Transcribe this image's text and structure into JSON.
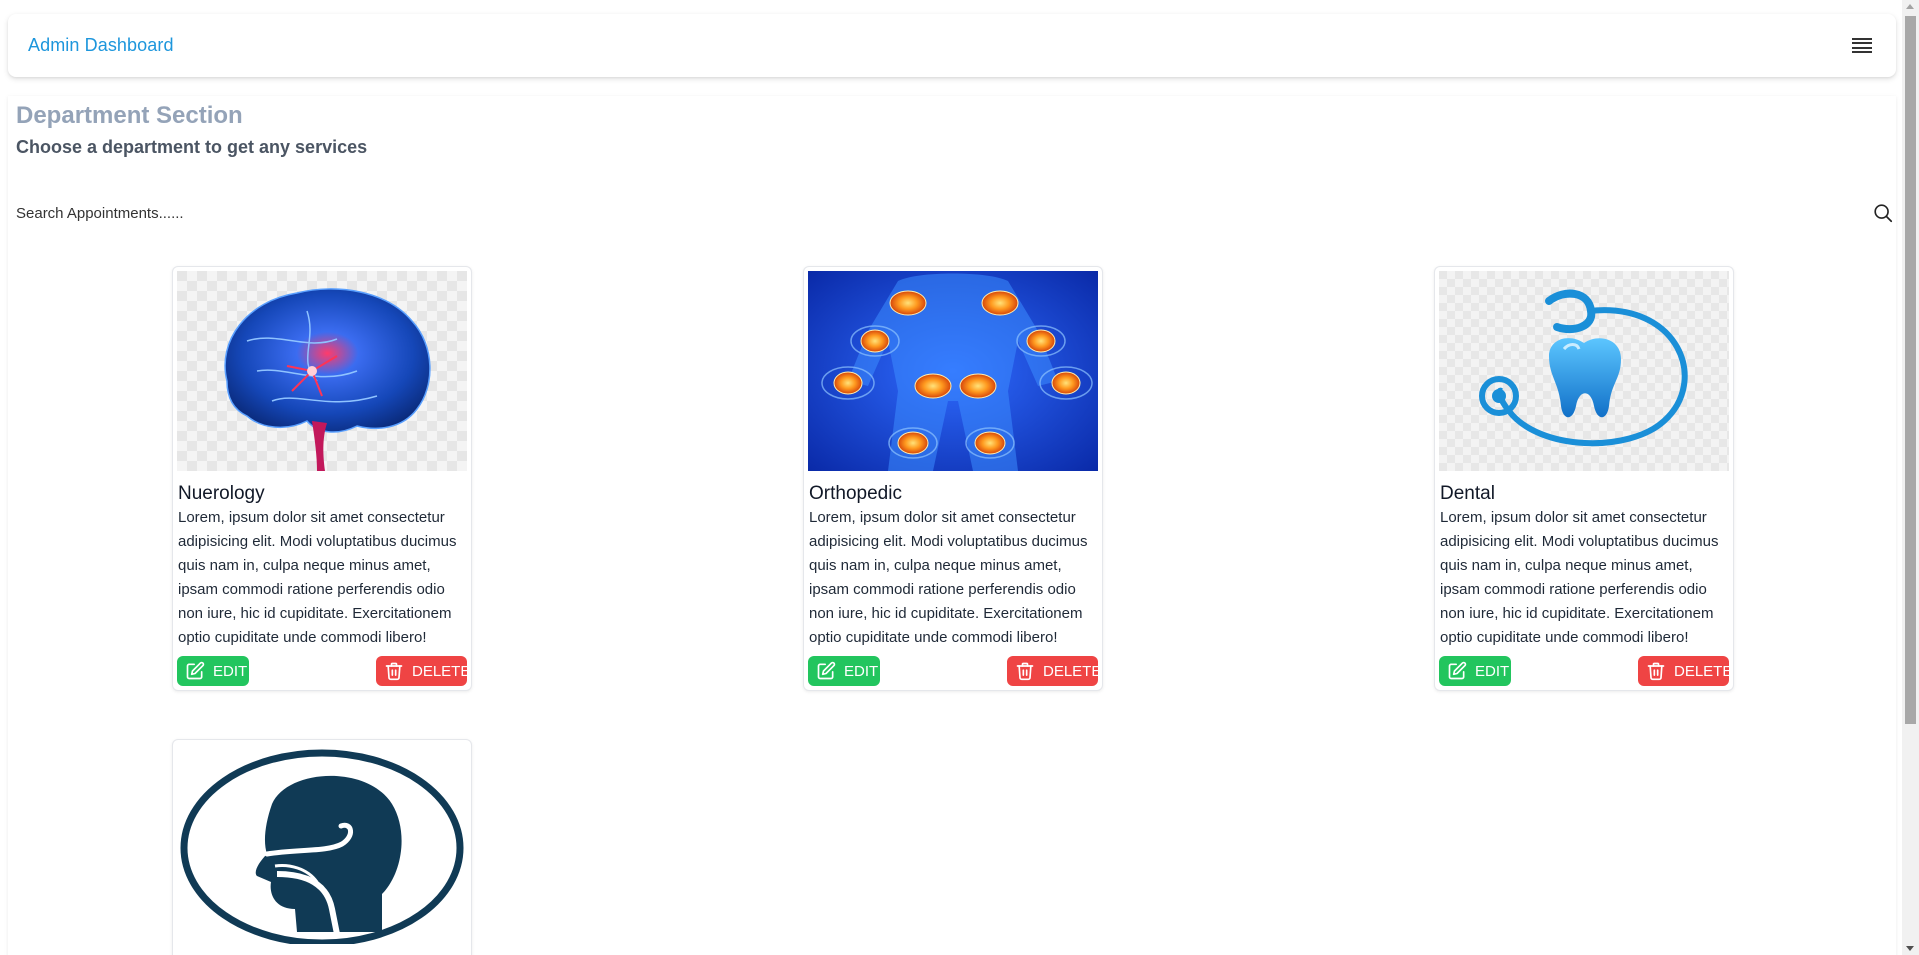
{
  "navbar": {
    "brand": "Admin Dashboard",
    "menu_icon": "hamburger-menu-icon"
  },
  "section": {
    "title": "Department Section",
    "subtitle": "Choose a department to get any services"
  },
  "search": {
    "placeholder": "Search Appointments......",
    "icon": "search-icon"
  },
  "departments": [
    {
      "name": "Nuerology",
      "description": "Lorem, ipsum dolor sit amet consectetur adipisicing elit. Modi voluptatibus ducimus quis nam in, culpa neque minus amet, ipsam commodi ratione perferendis odio non iure, hic id cupiditate. Exercitationem optio cupiditate unde commodi libero!",
      "image": "brain-image",
      "edit_label": "EDIT",
      "delete_label": "DELETE"
    },
    {
      "name": "Orthopedic",
      "description": "Lorem, ipsum dolor sit amet consectetur adipisicing elit. Modi voluptatibus ducimus quis nam in, culpa neque minus amet, ipsam commodi ratione perferendis odio non iure, hic id cupiditate. Exercitationem optio cupiditate unde commodi libero!",
      "image": "skeleton-joints-image",
      "edit_label": "EDIT",
      "delete_label": "DELETE"
    },
    {
      "name": "Dental",
      "description": "Lorem, ipsum dolor sit amet consectetur adipisicing elit. Modi voluptatibus ducimus quis nam in, culpa neque minus amet, ipsam commodi ratione perferendis odio non iure, hic id cupiditate. Exercitationem optio cupiditate unde commodi libero!",
      "image": "tooth-stethoscope-image",
      "edit_label": "EDIT",
      "delete_label": "DELETE"
    },
    {
      "image": "ent-head-image"
    }
  ],
  "colors": {
    "brand": "#1d96dc",
    "edit": "#22c55e",
    "delete": "#ef4444",
    "title_muted": "#94a3b8"
  }
}
